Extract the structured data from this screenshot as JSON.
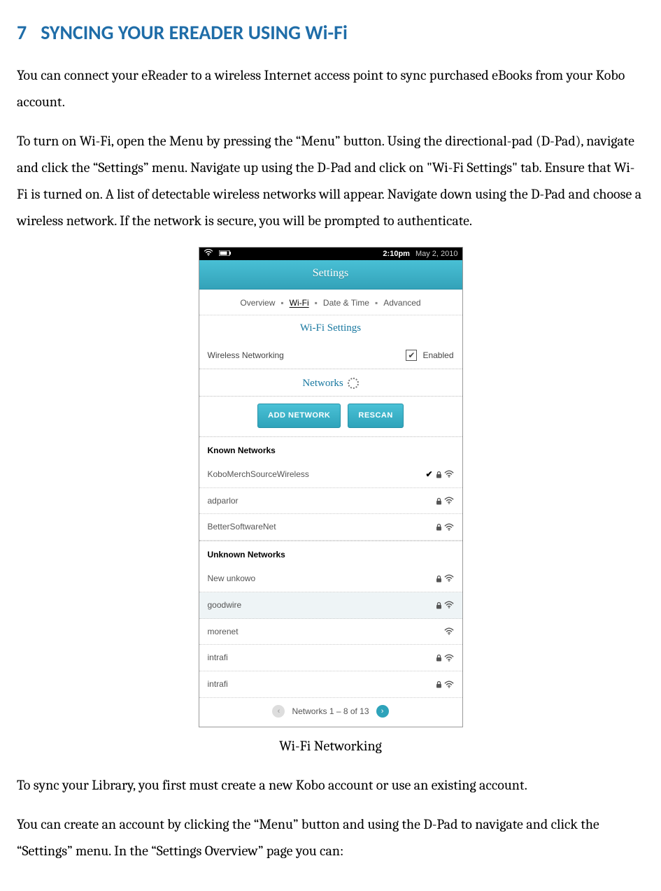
{
  "heading": {
    "number": "7",
    "title": "SYNCING YOUR EREADER USING Wi-Fi"
  },
  "para1": "You can connect your eReader to a wireless Internet access point to sync purchased eBooks from your Kobo account.",
  "para2": "To turn on Wi-Fi, open the Menu by pressing the “Menu” button. Using the directional-pad (D-Pad), navigate and click the “Settings” menu. Navigate up using the D-Pad and click on \"Wi-Fi Settings\" tab. Ensure that Wi-Fi is turned on. A list of detectable wireless networks will appear. Navigate down using the D-Pad and choose a wireless network. If the network is secure, you will be prompted to authenticate.",
  "screenshot": {
    "status": {
      "time": "2:10pm",
      "date": "May 2, 2010"
    },
    "banner": "Settings",
    "tabs": [
      "Overview",
      "Wi-Fi",
      "Date & Time",
      "Advanced"
    ],
    "active_tab": "Wi-Fi",
    "section_label": "Wi-Fi Settings",
    "enable_row": {
      "label": "Wireless Networking",
      "state": "Enabled",
      "checked": true
    },
    "networks_label": "Networks",
    "buttons": {
      "add": "ADD NETWORK",
      "rescan": "RESCAN"
    },
    "known_label": "Known Networks",
    "known": [
      {
        "name": "KoboMerchSourceWireless",
        "connected": true,
        "locked": true,
        "signal": true
      },
      {
        "name": "adparlor",
        "connected": false,
        "locked": true,
        "signal": true
      },
      {
        "name": "BetterSoftwareNet",
        "connected": false,
        "locked": true,
        "signal": true
      }
    ],
    "unknown_label": "Unknown Networks",
    "unknown": [
      {
        "name": "New unkowo",
        "locked": true,
        "signal": true,
        "selected": false
      },
      {
        "name": "goodwire",
        "locked": true,
        "signal": true,
        "selected": true
      },
      {
        "name": "morenet",
        "locked": false,
        "signal": true,
        "selected": false
      },
      {
        "name": "intrafi",
        "locked": true,
        "signal": true,
        "selected": false
      },
      {
        "name": "intrafi",
        "locked": true,
        "signal": true,
        "selected": false
      }
    ],
    "pager": {
      "text": "Networks 1 – 8 of 13",
      "prev_enabled": false,
      "next_enabled": true
    }
  },
  "caption": "Wi-Fi Networking",
  "para3": "To sync your Library, you first must create a new Kobo account or use an existing account.",
  "para4": "You can create an account by clicking the “Menu” button and using the D-Pad to navigate and click the “Settings” menu. In the “Settings Overview” page you can:"
}
